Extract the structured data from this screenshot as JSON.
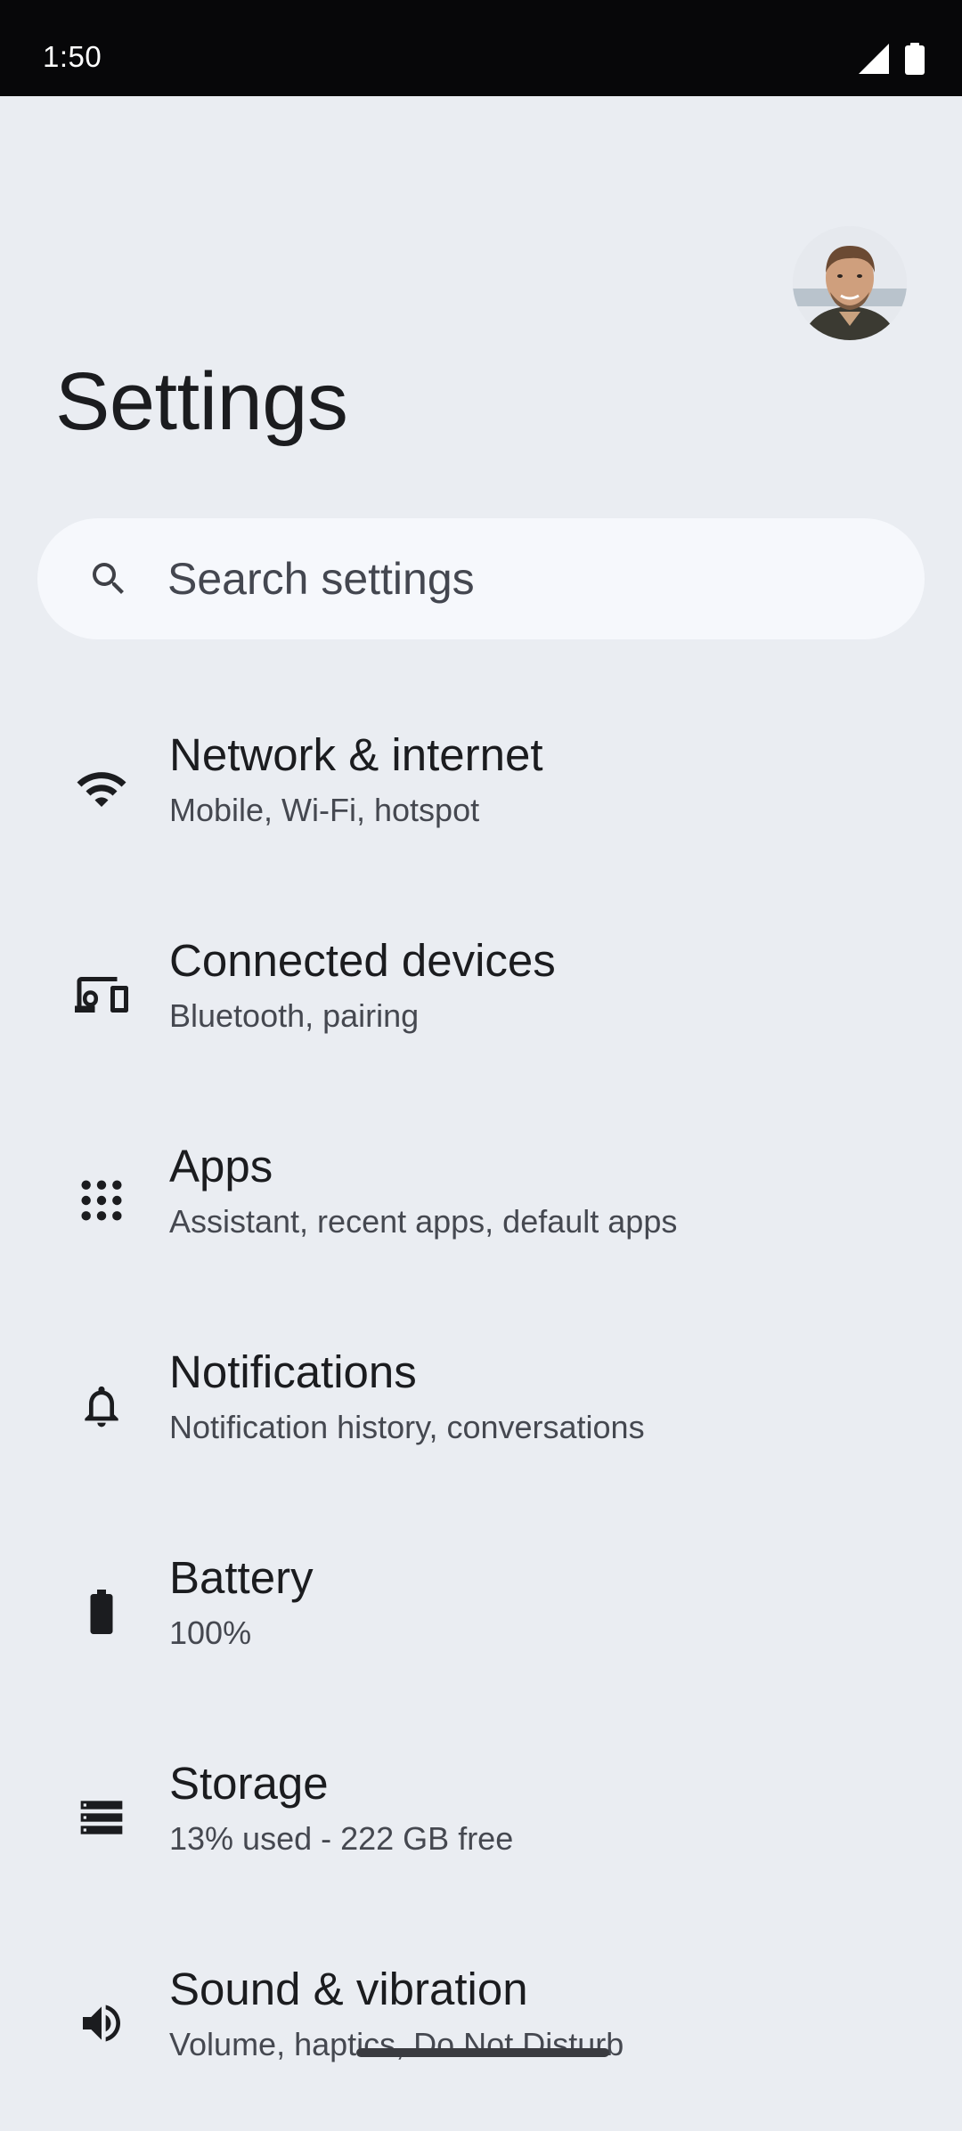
{
  "status_bar": {
    "time": "1:50",
    "icons": [
      "cellular-signal-icon",
      "battery-full-icon"
    ]
  },
  "header": {
    "title": "Settings",
    "avatar": "user-profile-photo"
  },
  "search": {
    "placeholder": "Search settings",
    "icon": "search-icon"
  },
  "settings": {
    "items": [
      {
        "title": "Network & internet",
        "subtitle": "Mobile, Wi-Fi, hotspot",
        "icon": "wifi-icon"
      },
      {
        "title": "Connected devices",
        "subtitle": "Bluetooth, pairing",
        "icon": "devices-icon"
      },
      {
        "title": "Apps",
        "subtitle": "Assistant, recent apps, default apps",
        "icon": "apps-grid-icon"
      },
      {
        "title": "Notifications",
        "subtitle": "Notification history, conversations",
        "icon": "bell-icon"
      },
      {
        "title": "Battery",
        "subtitle": "100%",
        "icon": "battery-icon"
      },
      {
        "title": "Storage",
        "subtitle": "13% used - 222 GB free",
        "icon": "storage-icon"
      },
      {
        "title": "Sound & vibration",
        "subtitle": "Volume, haptics, Do Not Disturb",
        "icon": "speaker-icon"
      }
    ]
  },
  "colors": {
    "background": "#eaedf2",
    "status_bar": "#070709",
    "search_bar": "#f6f8fc",
    "text_primary": "#1b1c1f",
    "text_secondary": "#454850"
  }
}
